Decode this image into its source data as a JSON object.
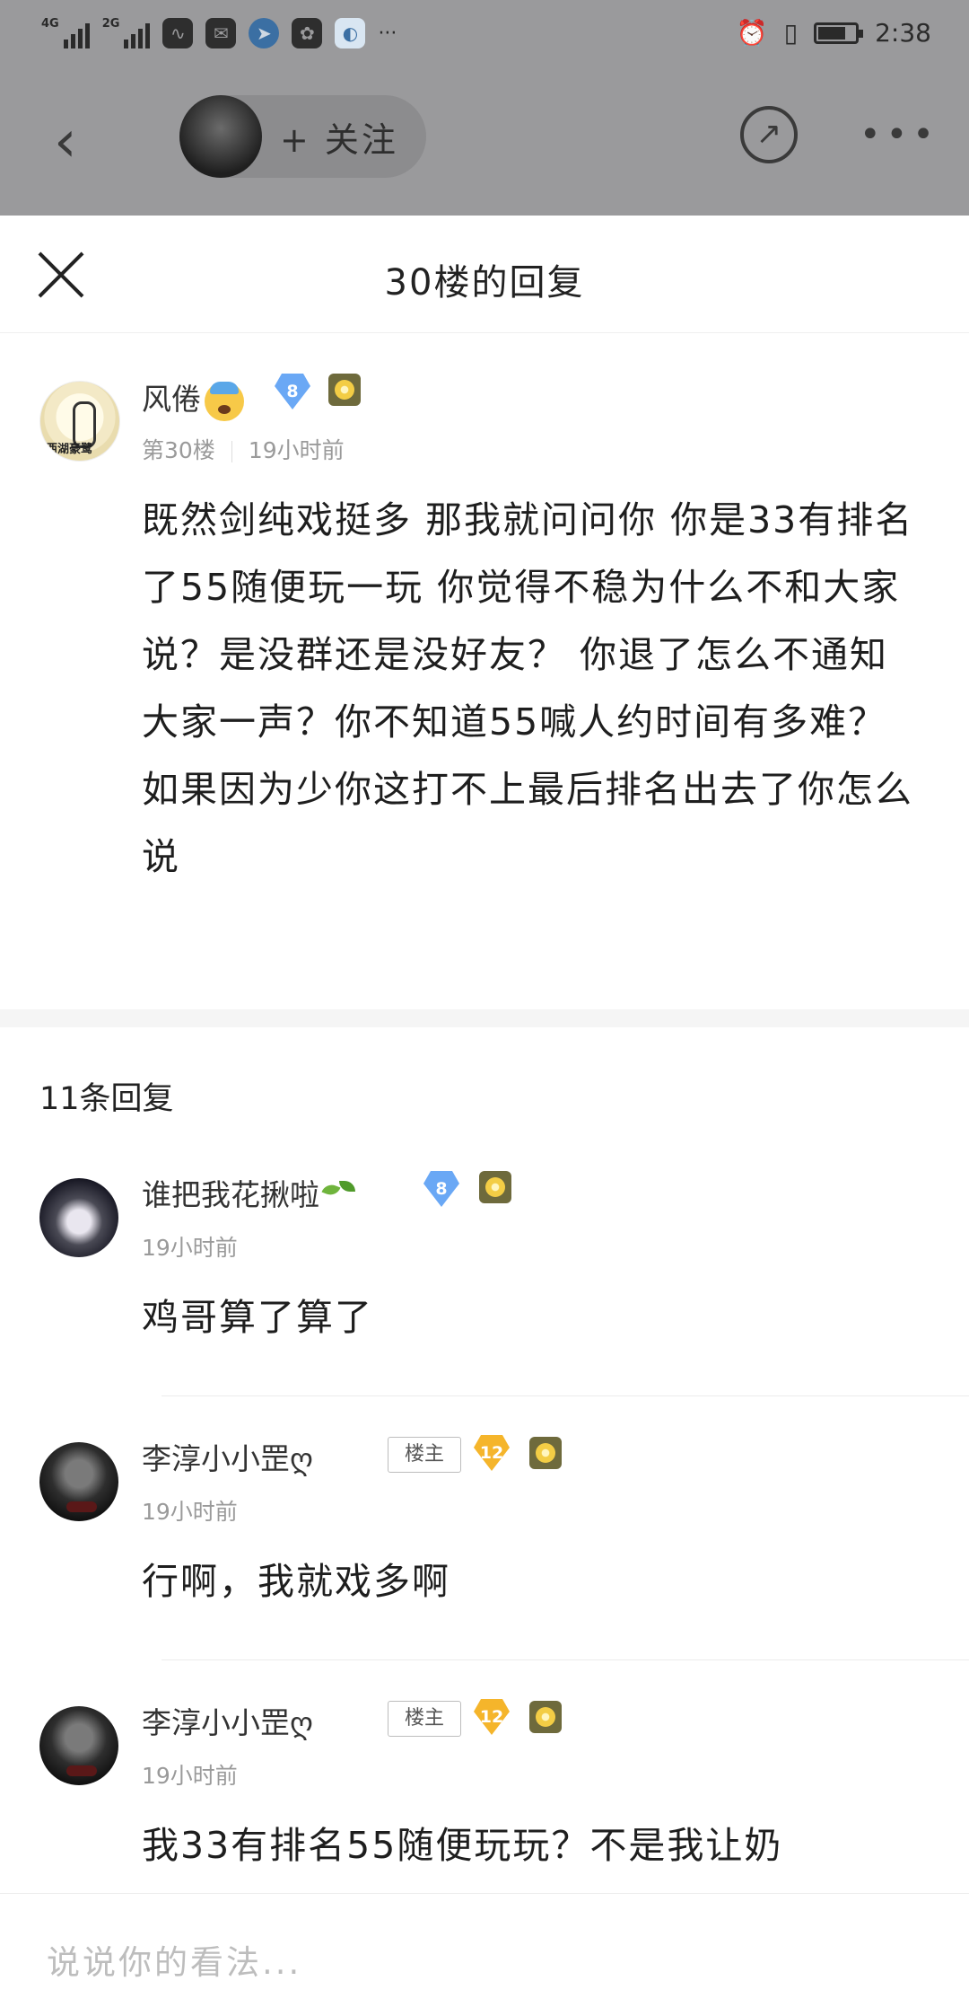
{
  "status_bar": {
    "network_left": "4G",
    "network_right": "2G",
    "more": "···",
    "time": "2:38"
  },
  "top_nav": {
    "follow_label": "+ 关注"
  },
  "sheet": {
    "title": "30楼的回复"
  },
  "post": {
    "author": "风倦",
    "level": "8",
    "floor": "第30楼",
    "time": "19小时前",
    "text": "既然剑纯戏挺多 那我就问问你 你是33有排名了55随便玩一玩 你觉得不稳为什么不和大家说？是没群还是没好友？ 你退了怎么不通知大家一声？你不知道55喊人约时间有多难？ 如果因为少你这打不上最后排名出去了你怎么说"
  },
  "reply_count": "11条回复",
  "replies": [
    {
      "author": "谁把我花揪啦",
      "level": "8",
      "owner_tag": "",
      "time": "19小时前",
      "text": "鸡哥算了算了"
    },
    {
      "author": "李淳小小罡ღ",
      "level": "12",
      "owner_tag": "楼主",
      "time": "19小时前",
      "text": "行啊，我就戏多啊"
    },
    {
      "author": "李淳小小罡ღ",
      "level": "12",
      "owner_tag": "楼主",
      "time": "19小时前",
      "text": "我33有排名55随便玩玩？不是我让奶"
    }
  ],
  "input": {
    "placeholder": "说说你的看法..."
  }
}
